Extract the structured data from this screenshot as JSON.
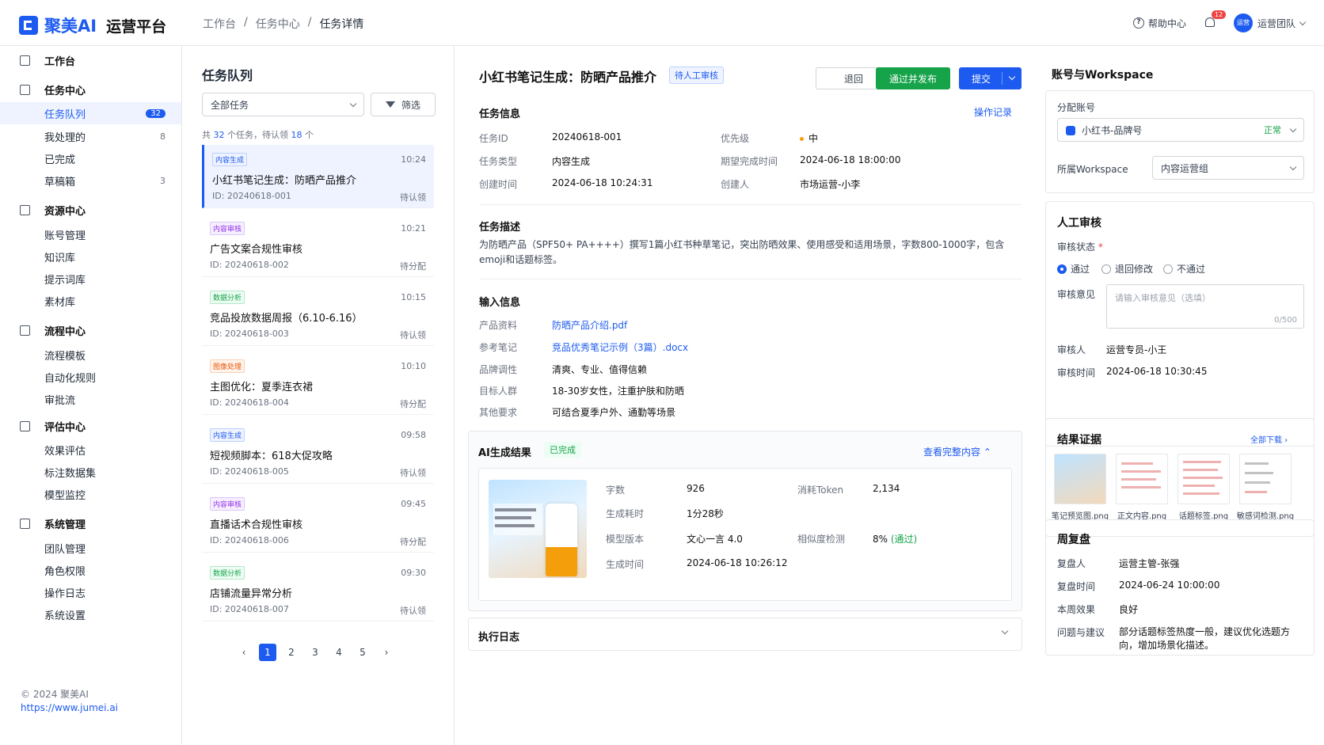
{
  "brand": {
    "name": "聚美AI",
    "platform": "运营平台"
  },
  "breadcrumb": [
    "工作台",
    "/",
    "任务中心",
    "/",
    "任务详情"
  ],
  "topbar": {
    "help": "帮助中心",
    "notify_count": "12",
    "avatar_text": "运营",
    "team": "运营团队"
  },
  "sidebar": {
    "items": [
      {
        "label": "工作台",
        "count": ""
      },
      {
        "label": "任务中心",
        "count": ""
      },
      {
        "label": "任务队列",
        "count": "32"
      },
      {
        "label": "我处理的",
        "count": "8"
      },
      {
        "label": "已完成",
        "count": ""
      },
      {
        "label": "草稿箱",
        "count": "3"
      },
      {
        "label": "资源中心",
        "count": ""
      },
      {
        "label": "账号管理",
        "count": ""
      },
      {
        "label": "知识库",
        "count": ""
      },
      {
        "label": "提示词库",
        "count": ""
      },
      {
        "label": "素材库",
        "count": ""
      },
      {
        "label": "流程中心",
        "count": ""
      },
      {
        "label": "流程模板",
        "count": ""
      },
      {
        "label": "自动化规则",
        "count": ""
      },
      {
        "label": "审批流",
        "count": ""
      },
      {
        "label": "评估中心",
        "count": ""
      },
      {
        "label": "效果评估",
        "count": ""
      },
      {
        "label": "标注数据集",
        "count": ""
      },
      {
        "label": "模型监控",
        "count": ""
      },
      {
        "label": "系统管理",
        "count": ""
      },
      {
        "label": "团队管理",
        "count": ""
      },
      {
        "label": "角色权限",
        "count": ""
      },
      {
        "label": "操作日志",
        "count": ""
      },
      {
        "label": "系统设置",
        "count": ""
      }
    ],
    "copyright": "© 2024 聚美AI",
    "site": "https://www.jumei.ai"
  },
  "queue": {
    "title": "任务队列",
    "filter_value": "全部任务",
    "filter_btn": "筛选",
    "count_pre": "共",
    "total": "32",
    "count_mid": "个任务，待认领",
    "pending": "18",
    "count_post": "个",
    "tasks": [
      {
        "tag": "内容生成",
        "time": "10:24",
        "name": "小红书笔记生成：防晒产品推介",
        "id": "ID: 20240618-001",
        "status": "待认领"
      },
      {
        "tag": "内容审核",
        "time": "10:21",
        "name": "广告文案合规性审核",
        "id": "ID: 20240618-002",
        "status": "待分配"
      },
      {
        "tag": "数据分析",
        "time": "10:15",
        "name": "竞品投放数据周报（6.10-6.16）",
        "id": "ID: 20240618-003",
        "status": "待认领"
      },
      {
        "tag": "图像处理",
        "time": "10:10",
        "name": "主图优化：夏季连衣裙",
        "id": "ID: 20240618-004",
        "status": "待分配"
      },
      {
        "tag": "内容生成",
        "time": "09:58",
        "name": "短视频脚本：618大促攻略",
        "id": "ID: 20240618-005",
        "status": "待认领"
      },
      {
        "tag": "内容审核",
        "time": "09:45",
        "name": "直播话术合规性审核",
        "id": "ID: 20240618-006",
        "status": "待分配"
      },
      {
        "tag": "数据分析",
        "time": "09:30",
        "name": "店铺流量异常分析",
        "id": "ID: 20240618-007",
        "status": "待认领"
      }
    ],
    "pages": [
      "1",
      "2",
      "3",
      "4",
      "5"
    ],
    "prev": "‹",
    "next": "›"
  },
  "detail": {
    "title": "小红书笔记生成：防晒产品推介",
    "status": "待人工审核",
    "btn_back": "退回",
    "btn_publish": "通过并发布",
    "btn_submit": "提交",
    "info_title": "任务信息",
    "op_log": "操作记录",
    "info": {
      "id_k": "任务ID",
      "id_v": "20240618-001",
      "pri_k": "优先级",
      "pri_v": "中",
      "type_k": "任务类型",
      "type_v": "内容生成",
      "due_k": "期望完成时间",
      "due_v": "2024-06-18 18:00:00",
      "created_k": "创建时间",
      "created_v": "2024-06-18 10:24:31",
      "creator_k": "创建人",
      "creator_v": "市场运营-小李"
    },
    "desc_title": "任务描述",
    "desc": "为防晒产品（SPF50+ PA++++）撰写1篇小红书种草笔记，突出防晒效果、使用感受和适用场景，字数800-1000字，包含emoji和话题标签。",
    "input_title": "输入信息",
    "inputs": [
      {
        "k": "产品资料",
        "v": "防晒产品介绍.pdf"
      },
      {
        "k": "参考笔记",
        "v": "竞品优秀笔记示例（3篇）.docx"
      },
      {
        "k": "品牌调性",
        "v": "清爽、专业、值得信赖"
      },
      {
        "k": "目标人群",
        "v": "18-30岁女性，注重护肤和防晒"
      },
      {
        "k": "其他要求",
        "v": "可结合夏季户外、通勤等场景"
      }
    ],
    "ai": {
      "title": "AI生成结果",
      "status": "已完成",
      "view": "查看完整内容",
      "words_k": "字数",
      "words_v": "926",
      "token_k": "消耗Token",
      "token_v": "2,134",
      "dur_k": "生成耗时",
      "dur_v": "1分28秒",
      "model_k": "模型版本",
      "model_v": "文心一言 4.0",
      "sim_k": "相似度检测",
      "sim_v": "8%",
      "sim_pass": "(通过)",
      "time_k": "生成时间",
      "time_v": "2024-06-18 10:26:12"
    },
    "log_title": "执行日志"
  },
  "panel": {
    "acc_title": "账号与Workspace",
    "assign_label": "分配账号",
    "account": "小红书-品牌号",
    "account_status": "正常",
    "ws_label": "所属Workspace",
    "ws_value": "内容运营组",
    "review_title": "人工审核",
    "review_status_label": "审核状态",
    "req": "*",
    "options": [
      "通过",
      "退回修改",
      "不通过"
    ],
    "opinion_label": "审核意见",
    "opinion_placeholder": "请输入审核意见（选填）",
    "opinion_counter": "0/500",
    "reviewer_k": "审核人",
    "reviewer_v": "运营专员-小王",
    "rtime_k": "审核时间",
    "rtime_v": "2024-06-18 10:30:45",
    "evidence_title": "结果证据",
    "download_all": "全部下载 ›",
    "files": [
      "笔记预览图.png",
      "正文内容.png",
      "话题标签.png",
      "敏感词检测.png"
    ],
    "weekly_title": "周复盘",
    "w_reviewer_k": "复盘人",
    "w_reviewer_v": "运营主管-张强",
    "w_time_k": "复盘时间",
    "w_time_v": "2024-06-24 10:00:00",
    "w_effect_k": "本周效果",
    "w_effect_v": "良好",
    "w_issue_k": "问题与建议",
    "w_issue_v": "部分话题标签热度一般，建议优化选题方向，增加场景化描述。"
  }
}
